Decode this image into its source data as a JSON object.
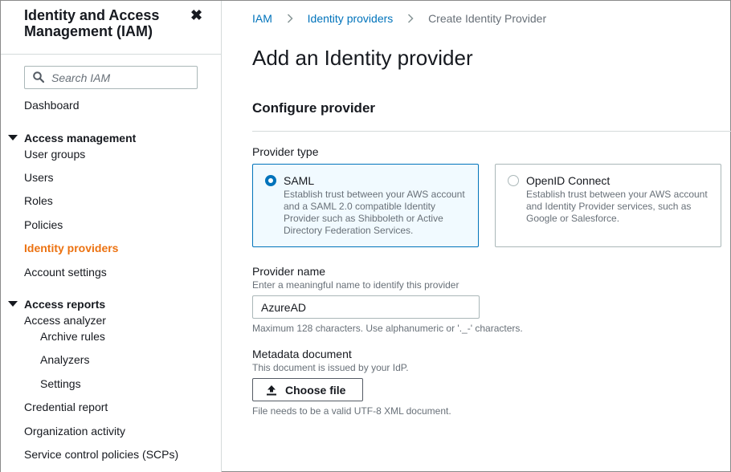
{
  "sidebar": {
    "title": "Identity and Access Management (IAM)",
    "close_glyph": "✖",
    "search_placeholder": "Search IAM",
    "dashboard": "Dashboard",
    "access_management": {
      "header": "Access management",
      "items": [
        "User groups",
        "Users",
        "Roles",
        "Policies",
        "Identity providers",
        "Account settings"
      ],
      "active": "Identity providers"
    },
    "access_reports": {
      "header": "Access reports",
      "access_analyzer": "Access analyzer",
      "analyzer_subitems": [
        "Archive rules",
        "Analyzers",
        "Settings"
      ],
      "items": [
        "Credential report",
        "Organization activity",
        "Service control policies (SCPs)"
      ]
    }
  },
  "breadcrumb": [
    "IAM",
    "Identity providers",
    "Create Identity Provider"
  ],
  "page_title": "Add an Identity provider",
  "section_title": "Configure provider",
  "provider_type": {
    "label": "Provider type",
    "options": [
      {
        "name": "SAML",
        "description": "Establish trust between your AWS account and a SAML 2.0 compatible Identity Provider such as Shibboleth or Active Directory Federation Services.",
        "selected": true
      },
      {
        "name": "OpenID Connect",
        "description": "Establish trust between your AWS account and Identity Provider services, such as Google or Salesforce.",
        "selected": false
      }
    ]
  },
  "provider_name": {
    "label": "Provider name",
    "description": "Enter a meaningful name to identify this provider",
    "value": "AzureAD",
    "constraint": "Maximum 128 characters. Use alphanumeric or '._-' characters."
  },
  "metadata": {
    "label": "Metadata document",
    "description": "This document is issued by your IdP.",
    "button_label": "Choose file",
    "hint": "File needs to be a valid UTF-8 XML document."
  },
  "colors": {
    "link": "#0073bb",
    "active_nav": "#ec7211",
    "selected_tile_bg": "#f1faff",
    "border": "#aab7b8"
  },
  "icons": {
    "search": "search-icon",
    "close": "close-icon",
    "caret": "caret-down-icon",
    "chevron": "chevron-right-icon",
    "radio": "radio-icon",
    "upload": "upload-icon"
  }
}
